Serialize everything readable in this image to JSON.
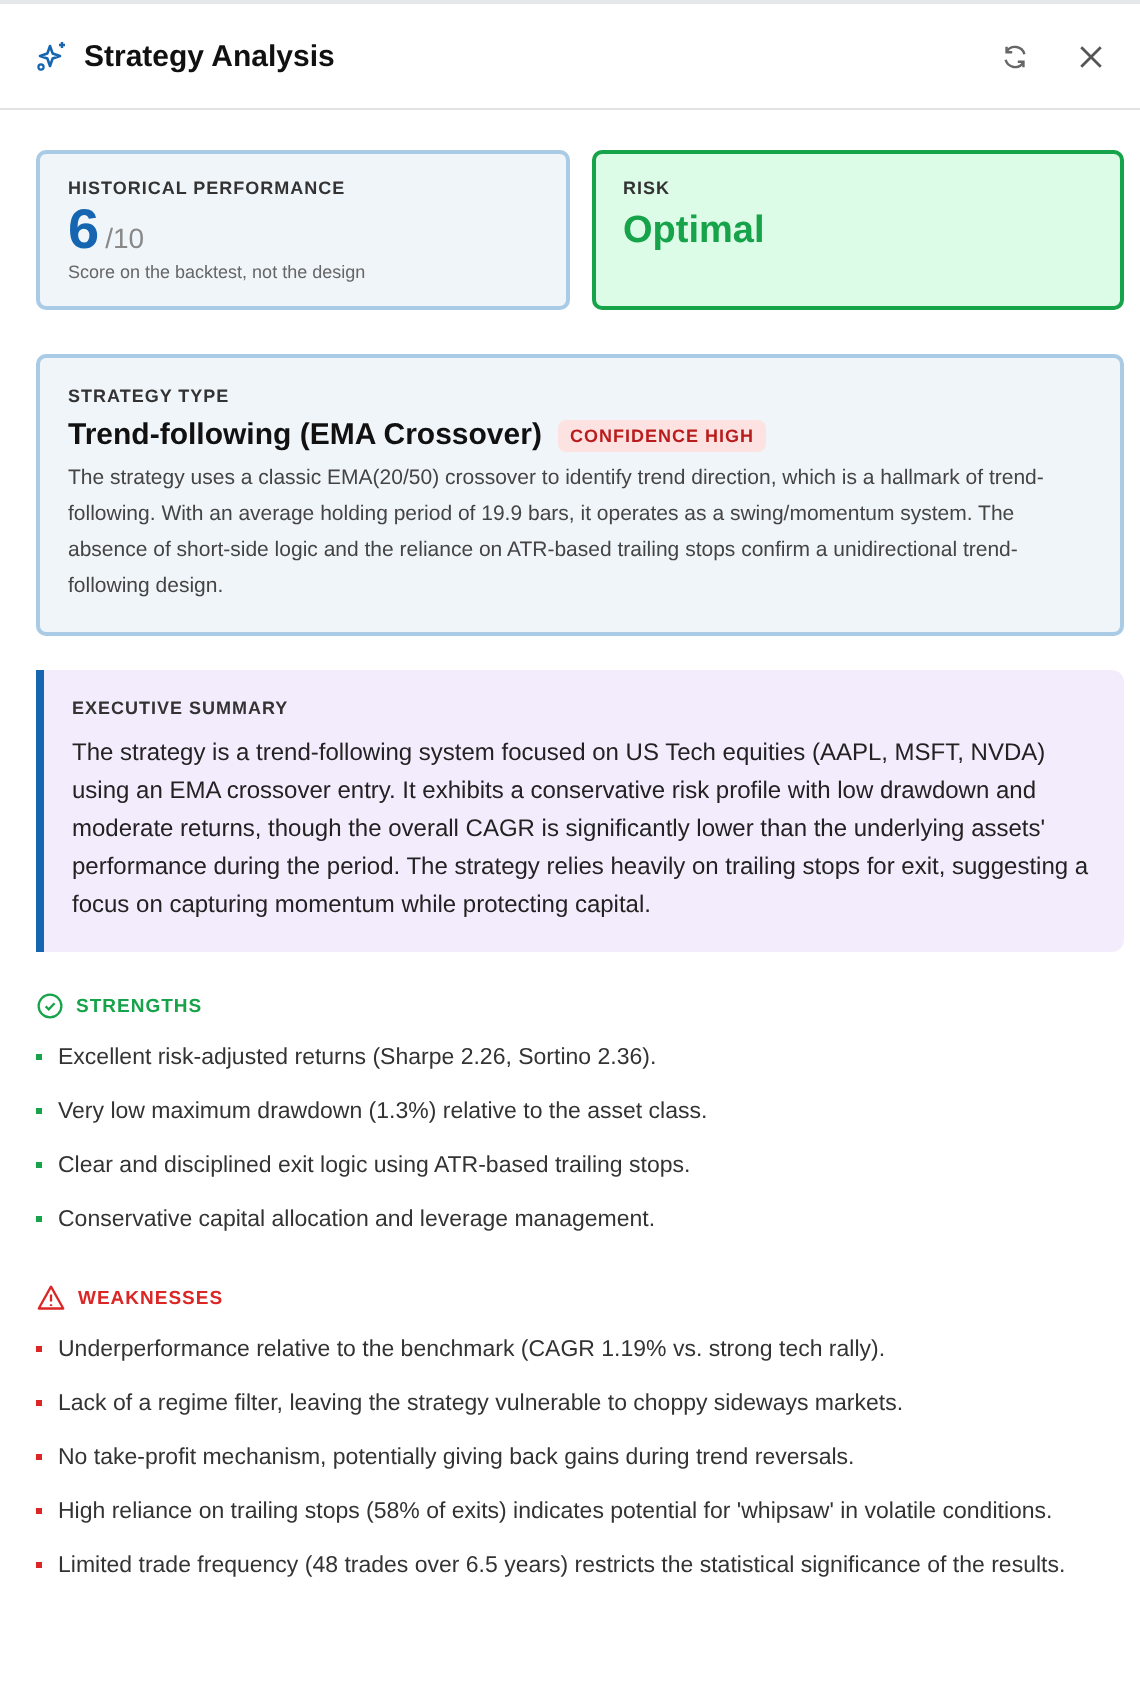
{
  "header": {
    "title": "Strategy Analysis"
  },
  "performance": {
    "label": "HISTORICAL PERFORMANCE",
    "score": "6",
    "max": "/10",
    "note": "Score on the backtest, not the design"
  },
  "risk": {
    "label": "RISK",
    "value": "Optimal"
  },
  "strategy_type": {
    "label": "STRATEGY TYPE",
    "name": "Trend-following (EMA Crossover)",
    "badge": "CONFIDENCE HIGH",
    "description": "The strategy uses a classic EMA(20/50) crossover to identify trend direction, which is a hallmark of trend-following. With an average holding period of 19.9 bars, it operates as a swing/momentum system. The absence of short-side logic and the reliance on ATR-based trailing stops confirm a unidirectional trend-following design."
  },
  "executive_summary": {
    "label": "EXECUTIVE SUMMARY",
    "text": "The strategy is a trend-following system focused on US Tech equities (AAPL, MSFT, NVDA) using an EMA crossover entry. It exhibits a conservative risk profile with low drawdown and moderate returns, though the overall CAGR is significantly lower than the underlying assets' performance during the period. The strategy relies heavily on trailing stops for exit, suggesting a focus on capturing momentum while protecting capital."
  },
  "sections": [
    {
      "kind": "strengths",
      "title": "STRENGTHS",
      "items": [
        "Excellent risk-adjusted returns (Sharpe 2.26, Sortino 2.36).",
        "Very low maximum drawdown (1.3%) relative to the asset class.",
        "Clear and disciplined exit logic using ATR-based trailing stops.",
        "Conservative capital allocation and leverage management."
      ]
    },
    {
      "kind": "weaknesses",
      "title": "WEAKNESSES",
      "items": [
        "Underperformance relative to the benchmark (CAGR 1.19% vs. strong tech rally).",
        "Lack of a regime filter, leaving the strategy vulnerable to choppy sideways markets.",
        "No take-profit mechanism, potentially giving back gains during trend reversals.",
        "High reliance on trailing stops (58% of exits) indicates potential for 'whipsaw' in volatile conditions.",
        "Limited trade frequency (48 trades over 6.5 years) restricts the statistical significance of the results."
      ]
    }
  ]
}
